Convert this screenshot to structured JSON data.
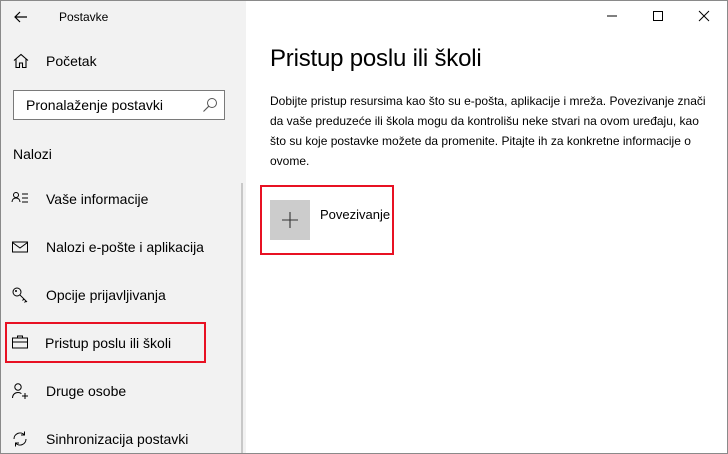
{
  "window": {
    "app_title": "Postavke"
  },
  "sidebar": {
    "home_label": "Početak",
    "search": {
      "placeholder": "Pronalaženje postavki"
    },
    "section_title": "Nalozi",
    "items": [
      {
        "label": "Vaše informacije",
        "icon": "person-info-icon"
      },
      {
        "label": "Nalozi e-pošte i aplikacija",
        "icon": "mail-icon"
      },
      {
        "label": "Opcije prijavljivanja",
        "icon": "key-icon"
      },
      {
        "label": "Pristup poslu ili školi",
        "icon": "briefcase-icon",
        "selected": true
      },
      {
        "label": "Druge osobe",
        "icon": "person-add-icon"
      },
      {
        "label": "Sinhronizacija postavki",
        "icon": "sync-icon"
      }
    ]
  },
  "main": {
    "title": "Pristup poslu ili školi",
    "description": "Dobijte pristup resursima kao što su e-pošta, aplikacije i mreža. Povezivanje znači da vaše preduzeće ili škola mogu da kontrolišu neke stvari na ovom uređaju, kao što su koje postavke možete da promenite. Pitajte ih za konkretne informacije o ovome.",
    "connect_label": "Povezivanje"
  },
  "colors": {
    "sidebar_bg": "#f2f2f2",
    "highlight": "#e81123",
    "plus_tile": "#cccccc"
  }
}
